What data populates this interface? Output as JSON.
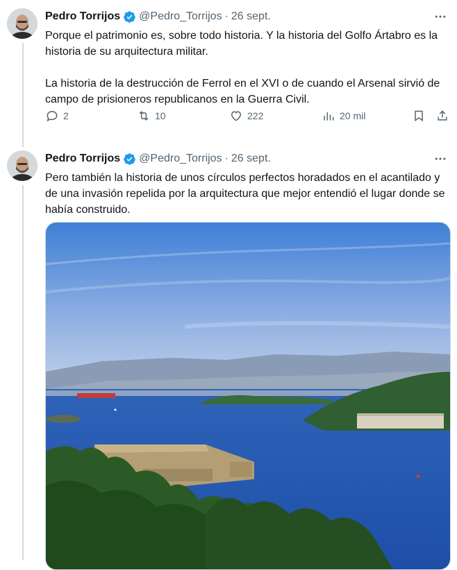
{
  "tweets": [
    {
      "author_name": "Pedro Torrijos",
      "handle": "@Pedro_Torrijos",
      "date": "26 sept.",
      "text": "Porque el patrimonio es, sobre todo historia. Y la historia del Golfo Ártabro es la historia de su arquitectura militar.\n\nLa historia de la destrucción de Ferrol en el XVI o de cuando el Arsenal sirvió de campo de prisioneros republicanos en la Guerra Civil.",
      "replies": "2",
      "retweets": "10",
      "likes": "222",
      "views": "20 mil"
    },
    {
      "author_name": "Pedro Torrijos",
      "handle": "@Pedro_Torrijos",
      "date": "26 sept.",
      "text": "Pero también la historia de unos círculos perfectos horadados en el acantilado y de una invasión repelida por la arquitectura que mejor entendió el lugar donde se había construido."
    }
  ],
  "colors": {
    "text": "#0f1419",
    "muted": "#536471",
    "verified": "#1d9bf0",
    "thread_line": "#cfd9de"
  },
  "icons": [
    "verified-badge-icon",
    "more-icon",
    "reply-icon",
    "retweet-icon",
    "like-icon",
    "views-icon",
    "bookmark-icon",
    "share-icon"
  ]
}
